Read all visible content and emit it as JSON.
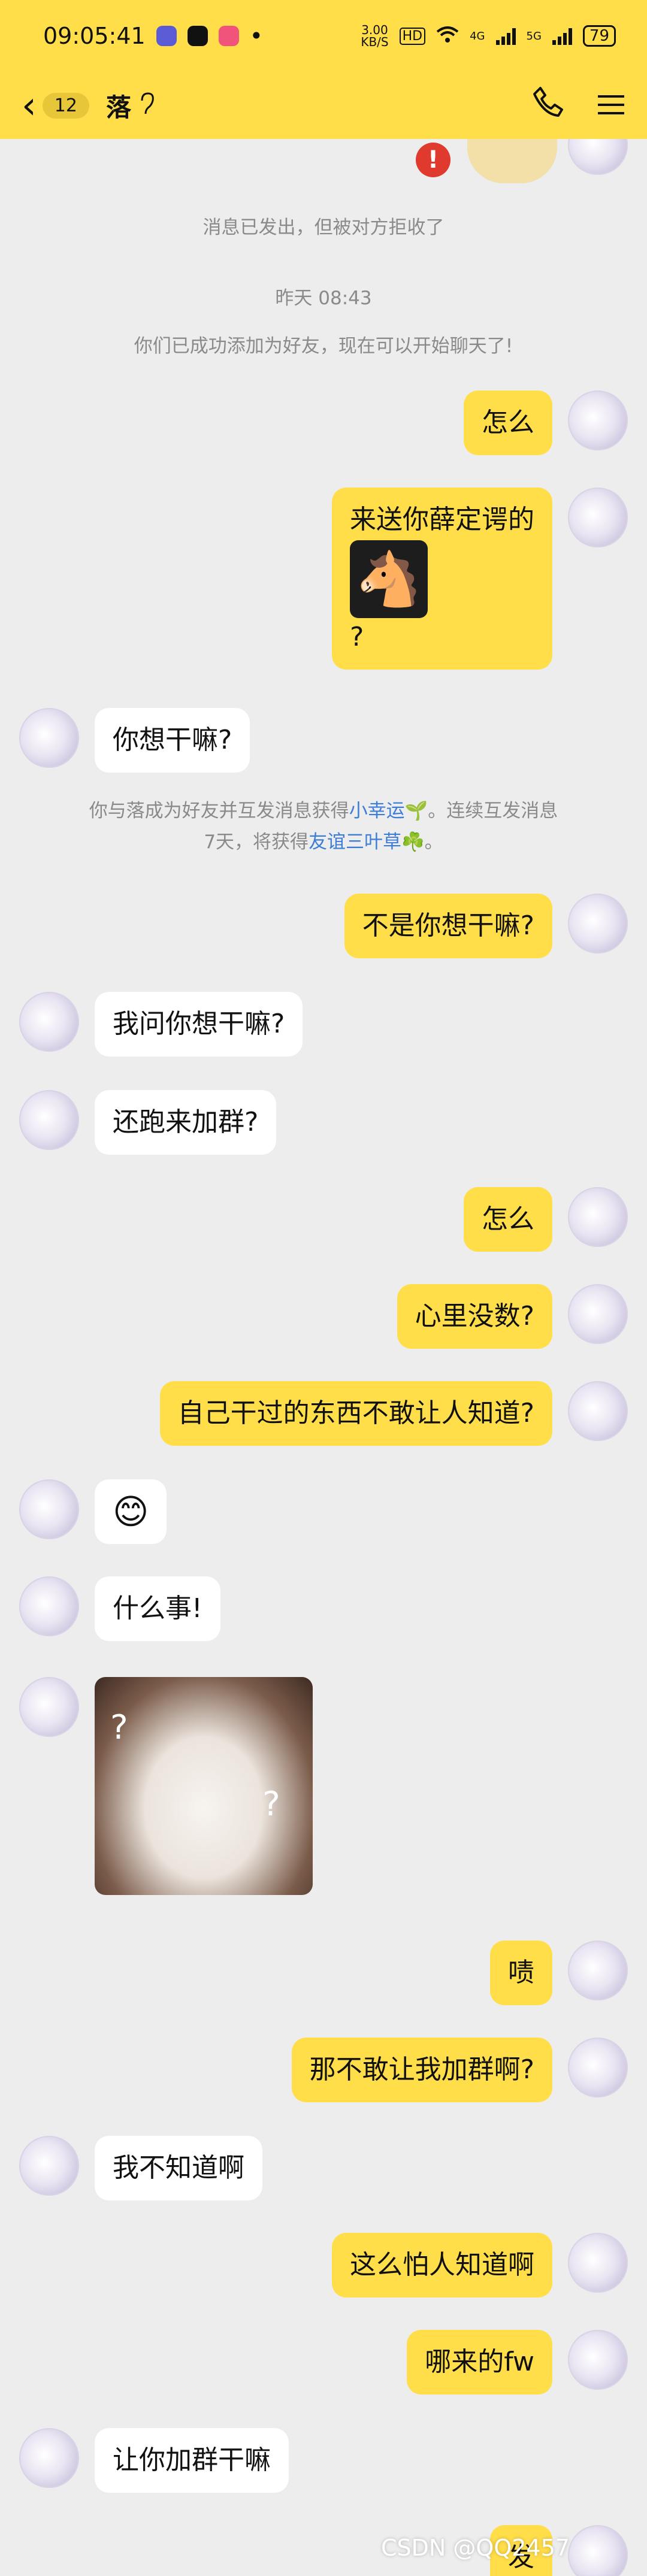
{
  "status_bar": {
    "time": "09:05:41",
    "net_speed": "3.00\nKB/S",
    "hd": "HD",
    "net_4g": "4G",
    "net_5g": "5G",
    "battery": "79",
    "colors": {
      "app1": "#5b5bd6",
      "app2": "#111111",
      "app3": "#f1547a"
    }
  },
  "top_bar": {
    "back_icon": "back-chevron-icon",
    "unread_count": "12",
    "chat_name": "落",
    "ear_icon": "ear-icon",
    "phone_icon": "phone-icon",
    "menu_icon": "menu-icon"
  },
  "system": {
    "rejected": "消息已发出，但被对方拒收了",
    "time_yesterday": "昨天 08:43",
    "friend_added": "你们已成功添加为好友，现在可以开始聊天了!",
    "reward_prefix": "你与落成为好友并互发消息获得",
    "reward_link1": "小幸运🌱",
    "reward_mid": "。连续互发消息7天，将获得",
    "reward_link2": "友谊三叶草☘️",
    "reward_suffix": "。"
  },
  "messages": [
    {
      "side": "right",
      "text": "怎么"
    },
    {
      "side": "right",
      "text": "来送你薛定谔的",
      "sticker": "🐴",
      "text2": "?"
    },
    {
      "side": "left",
      "text": "你想干嘛?"
    },
    {
      "side": "right",
      "text": "不是你想干嘛?"
    },
    {
      "side": "left",
      "text": "我问你想干嘛?"
    },
    {
      "side": "left",
      "text": "还跑来加群?"
    },
    {
      "side": "right",
      "text": "怎么"
    },
    {
      "side": "right",
      "text": "心里没数?"
    },
    {
      "side": "right",
      "text": "自己干过的东西不敢让人知道?"
    },
    {
      "side": "left",
      "text": "😊"
    },
    {
      "side": "left",
      "text": "什么事!"
    },
    {
      "side": "left",
      "image": "cat-image",
      "qmark": "?"
    },
    {
      "side": "right",
      "text": "啧"
    },
    {
      "side": "right",
      "text": "那不敢让我加群啊?"
    },
    {
      "side": "left",
      "text": "我不知道啊"
    },
    {
      "side": "right",
      "text": "这么怕人知道啊"
    },
    {
      "side": "right",
      "text": "哪来的fw"
    },
    {
      "side": "left",
      "text": "让你加群干嘛"
    },
    {
      "side": "right",
      "text": "发"
    }
  ],
  "watermark": "CSDN @QQ2457"
}
